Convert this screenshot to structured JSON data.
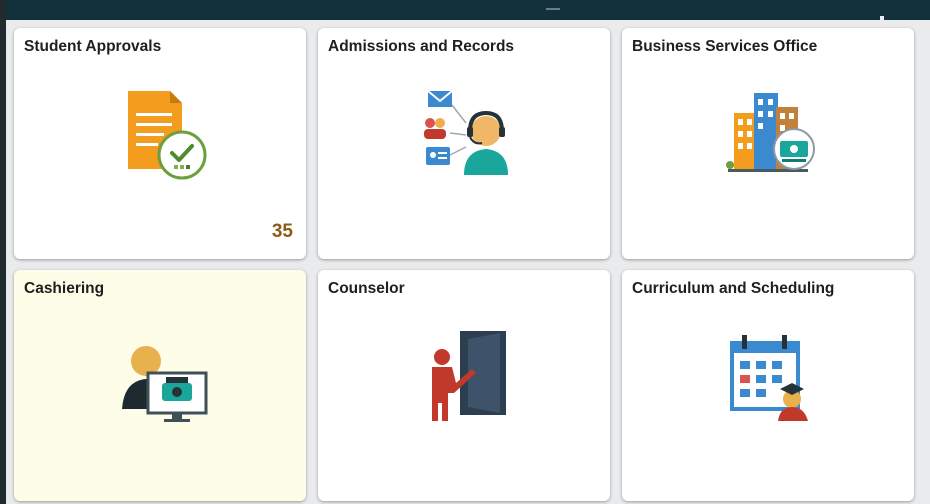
{
  "tiles": [
    {
      "title": "Student Approvals",
      "icon": "document-approval-icon",
      "badge": "35"
    },
    {
      "title": "Admissions and Records",
      "icon": "call-center-agent-icon"
    },
    {
      "title": "Business Services Office",
      "icon": "office-buildings-money-icon"
    },
    {
      "title": "Cashiering",
      "icon": "cashier-monitor-icon"
    },
    {
      "title": "Counselor",
      "icon": "counselor-door-icon"
    },
    {
      "title": "Curriculum and Scheduling",
      "icon": "calendar-graduate-icon"
    }
  ],
  "colors": {
    "topbar": "#12313a",
    "tile_background": "#ffffff",
    "highlighted_tile_background": "#fefde8",
    "badge": "#8a5c14"
  }
}
